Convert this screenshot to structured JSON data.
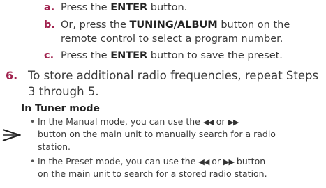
{
  "substeps": [
    {
      "label": "a.",
      "pre": "Press the ",
      "bold": "ENTER",
      "post": " button."
    },
    {
      "label": "b.",
      "pre": "Or, press the ",
      "bold": "TUNING/ALBUM",
      "post": " button on the",
      "cont": "remote control to select a program number."
    },
    {
      "label": "c.",
      "pre": "Press the ",
      "bold": "ENTER",
      "post": " button to save the preset."
    }
  ],
  "step6": {
    "number": "6.",
    "line1": "To store additional radio frequencies, repeat Steps",
    "line2": "3 through 5."
  },
  "note": {
    "heading": "In Tuner mode",
    "bullet_char": "•",
    "prev_symbol": "◀◀",
    "next_symbol": "▶▶",
    "bullets": [
      {
        "pre": "In the Manual mode, you can use the ",
        "or": " or ",
        "post": "",
        "line2": "button on the main unit to manually search for a radio",
        "line3": "station."
      },
      {
        "pre": "In the Preset mode, you can use the ",
        "or": " or ",
        "post": " button",
        "line2": "on the main unit to search for a stored radio station."
      }
    ]
  }
}
